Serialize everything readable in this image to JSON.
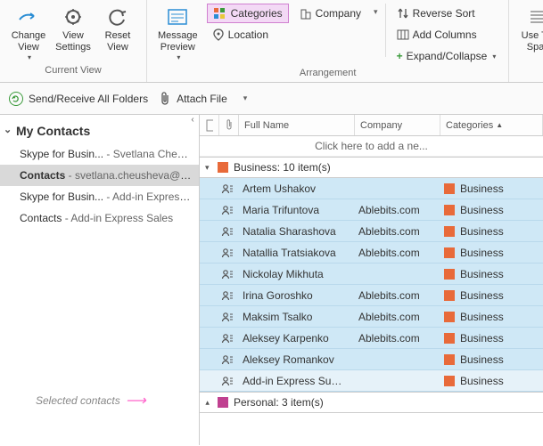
{
  "ribbon": {
    "change_view": "Change\nView",
    "view_settings": "View\nSettings",
    "reset_view": "Reset\nView",
    "group1_label": "Current View",
    "message_preview": "Message\nPreview",
    "categories": "Categories",
    "company": "Company",
    "location": "Location",
    "group2_label": "Arrangement",
    "reverse_sort": "Reverse Sort",
    "add_columns": "Add Columns",
    "expand_collapse": "Expand/Collapse",
    "use_tighter": "Use Tig\nSpac"
  },
  "toolbar": {
    "send_receive": "Send/Receive All Folders",
    "attach_file": "Attach File"
  },
  "nav": {
    "header": "My Contacts",
    "items": [
      {
        "main": "Skype for Busin...",
        "sub": " - Svetlana Cheus..."
      },
      {
        "main": "Contacts",
        "sub": " - svetlana.cheusheva@a..."
      },
      {
        "main": "Skype for Busin...",
        "sub": " - Add-in Express..."
      },
      {
        "main": "Contacts",
        "sub": " - Add-in Express Sales"
      }
    ],
    "callout": "Selected contacts"
  },
  "columns": {
    "fullname": "Full Name",
    "company": "Company",
    "categories": "Categories"
  },
  "list": {
    "new_hint": "Click here to add a ne...",
    "group1": "Business: 10 item(s)",
    "group2": "Personal: 3 item(s)",
    "rows": [
      {
        "name": "Artem Ushakov",
        "company": "",
        "cat": "Business"
      },
      {
        "name": "Maria Trifuntova",
        "company": "Ablebits.com",
        "cat": "Business"
      },
      {
        "name": "Natalia Sharashova",
        "company": "Ablebits.com",
        "cat": "Business"
      },
      {
        "name": "Natallia Tratsiakova",
        "company": "Ablebits.com",
        "cat": "Business"
      },
      {
        "name": "Nickolay Mikhuta",
        "company": "",
        "cat": "Business"
      },
      {
        "name": "Irina Goroshko",
        "company": "Ablebits.com",
        "cat": "Business"
      },
      {
        "name": "Maksim Tsalko",
        "company": "Ablebits.com",
        "cat": "Business"
      },
      {
        "name": "Aleksey Karpenko",
        "company": "Ablebits.com",
        "cat": "Business"
      },
      {
        "name": "Aleksey Romankov",
        "company": "",
        "cat": "Business"
      },
      {
        "name": "Add-in Express Suppor...",
        "company": "",
        "cat": "Business"
      }
    ]
  }
}
